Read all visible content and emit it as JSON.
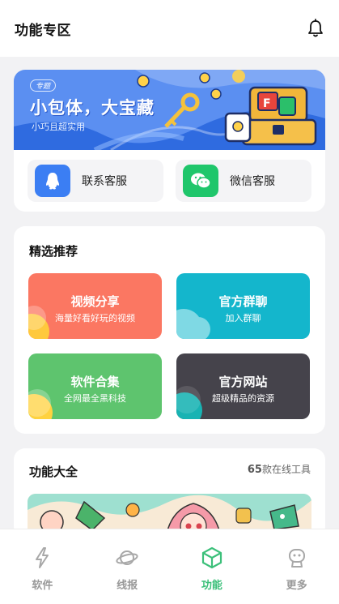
{
  "header": {
    "title": "功能专区",
    "bell_icon": "bell-icon"
  },
  "banner": {
    "tag": "专题",
    "headline": "小包体，大宝藏",
    "subtitle": "小巧且超实用",
    "bg_color": "#5b8ff1"
  },
  "contacts": [
    {
      "label": "联系客服",
      "icon": "qq-penguin-icon",
      "color": "#3b7ef3"
    },
    {
      "label": "微信客服",
      "icon": "wechat-icon",
      "color": "#1fc66b"
    }
  ],
  "recommend": {
    "title": "精选推荐",
    "tiles": [
      {
        "title": "视频分享",
        "subtitle": "海量好看好玩的视频",
        "color": "#fb7762"
      },
      {
        "title": "官方群聊",
        "subtitle": "加入群聊",
        "color": "#14b6cc"
      },
      {
        "title": "软件合集",
        "subtitle": "全网最全黑科技",
        "color": "#5ec46e"
      },
      {
        "title": "官方网站",
        "subtitle": "超级精品的资源",
        "color": "#45434b"
      }
    ]
  },
  "tools": {
    "title": "功能大全",
    "count_number": "65",
    "count_text": "款在线工具"
  },
  "tabbar": {
    "accent": "#3cc07a",
    "items": [
      {
        "label": "软件",
        "icon": "lightning-icon",
        "active": false
      },
      {
        "label": "线报",
        "icon": "planet-icon",
        "active": false
      },
      {
        "label": "功能",
        "icon": "cube-icon",
        "active": true
      },
      {
        "label": "更多",
        "icon": "robot-icon",
        "active": false
      }
    ]
  }
}
